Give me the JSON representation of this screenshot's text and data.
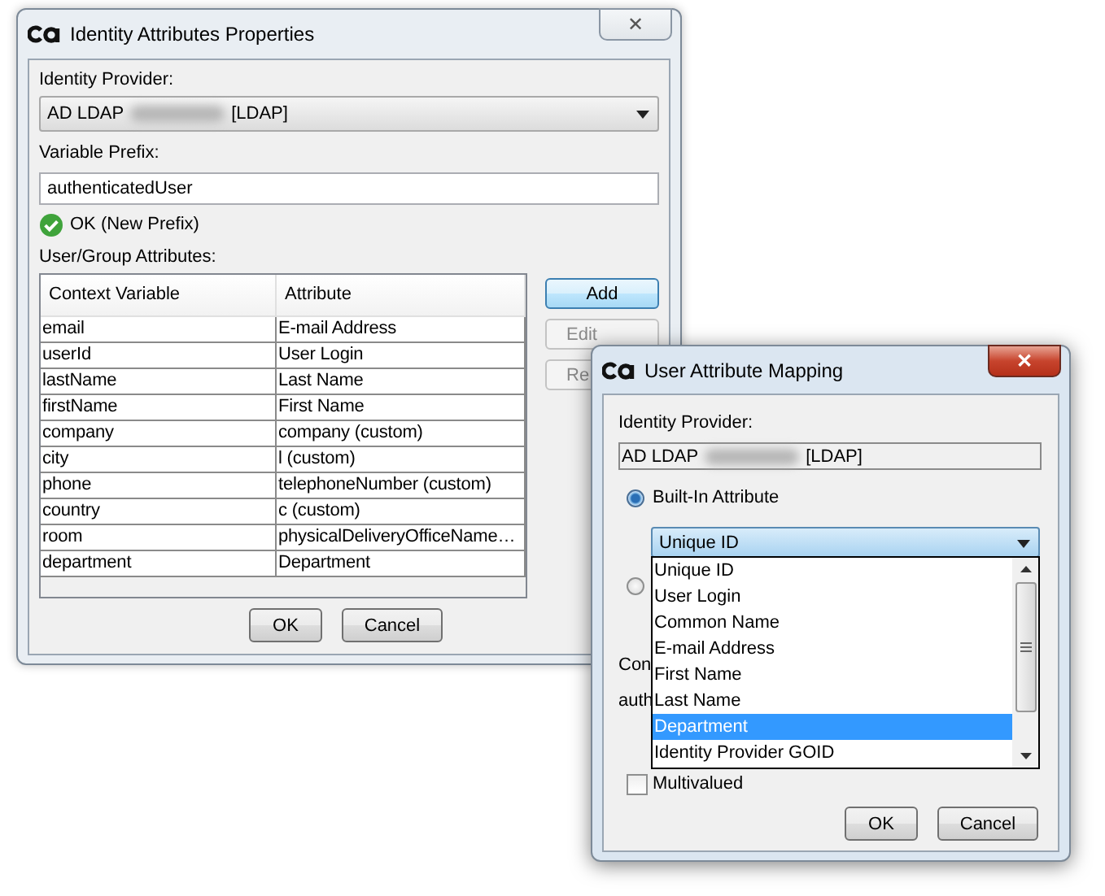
{
  "properties_dialog": {
    "title": "Identity Attributes Properties",
    "close_label": "✕",
    "identity_provider_label": "Identity Provider:",
    "identity_provider": {
      "prefix": "AD LDAP",
      "suffix": "[LDAP]"
    },
    "variable_prefix_label": "Variable Prefix:",
    "variable_prefix": "authenticatedUser",
    "validation": {
      "valid": true,
      "message": "OK (New Prefix)"
    },
    "attributes_label": "User/Group Attributes:",
    "table": {
      "columns": [
        "Context Variable",
        "Attribute"
      ],
      "rows": [
        [
          "email",
          "E-mail Address"
        ],
        [
          "userId",
          "User Login"
        ],
        [
          "lastName",
          "Last Name"
        ],
        [
          "firstName",
          "First Name"
        ],
        [
          "company",
          "company (custom)"
        ],
        [
          "city",
          "l (custom)"
        ],
        [
          "phone",
          "telephoneNumber (custom)"
        ],
        [
          "country",
          "c (custom)"
        ],
        [
          "room",
          "physicalDeliveryOfficeName…"
        ],
        [
          "department",
          "Department"
        ]
      ]
    },
    "side_buttons": [
      {
        "label": "Add",
        "disabled": false,
        "default": true
      },
      {
        "label": "Edit",
        "disabled": true,
        "default": false
      },
      {
        "label": "Re",
        "disabled": true,
        "default": false
      }
    ],
    "buttons": [
      "OK",
      "Cancel"
    ]
  },
  "mapping_dialog": {
    "title": "User Attribute Mapping",
    "close_label": "✕",
    "identity_provider_label": "Identity Provider:",
    "identity_provider": {
      "prefix": "AD LDAP",
      "suffix": "[LDAP]"
    },
    "radios": [
      {
        "label": "Built-In Attribute",
        "selected": true
      },
      {
        "selected": false
      }
    ],
    "combo": {
      "value": "Unique ID",
      "open": true
    },
    "list": [
      {
        "label": "Unique ID",
        "selected": false
      },
      {
        "label": "User Login",
        "selected": false
      },
      {
        "label": "Common Name",
        "selected": false
      },
      {
        "label": "E-mail Address",
        "selected": false
      },
      {
        "label": "First Name",
        "selected": false
      },
      {
        "label": "Last Name",
        "selected": false
      },
      {
        "label": "Department",
        "selected": true
      },
      {
        "label": "Identity Provider GOID",
        "selected": false
      }
    ],
    "partial_texts": [
      "Con",
      "auth"
    ],
    "multivalued": {
      "label": "Multivalued",
      "checked": false
    },
    "buttons": [
      "OK",
      "Cancel"
    ]
  }
}
